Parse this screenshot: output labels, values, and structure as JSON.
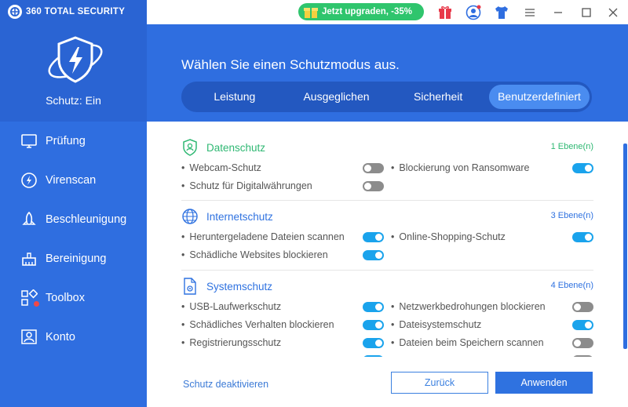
{
  "brand": {
    "name": "360 TOTAL SECURITY"
  },
  "sidebar": {
    "status": "Schutz: Ein",
    "items": [
      {
        "label": "Prüfung",
        "icon": "monitor-icon"
      },
      {
        "label": "Virenscan",
        "icon": "lightning-circle-icon"
      },
      {
        "label": "Beschleunigung",
        "icon": "rocket-icon"
      },
      {
        "label": "Bereinigung",
        "icon": "broom-icon"
      },
      {
        "label": "Toolbox",
        "icon": "grid-icon"
      },
      {
        "label": "Konto",
        "icon": "account-icon"
      }
    ]
  },
  "topbar": {
    "upgrade_label": "Jetzt upgraden, -35%",
    "colors": {
      "upgrade": "#2fc56d",
      "gift": "#e8394a",
      "shirt": "#2f6ee0"
    }
  },
  "header": {
    "title": "Wählen Sie einen Schutzmodus aus.",
    "tabs": [
      "Leistung",
      "Ausgeglichen",
      "Sicherheit",
      "Benutzerdefiniert"
    ],
    "active_tab": "Benutzerdefiniert"
  },
  "sections": [
    {
      "title": "Datenschutz",
      "level": "1 Ebene(n)",
      "color": "#2fb873",
      "items": [
        {
          "label": "Webcam-Schutz",
          "on": false
        },
        {
          "label": "Blockierung von Ransomware",
          "on": true
        },
        {
          "label": "Schutz für Digitalwährungen",
          "on": false
        }
      ]
    },
    {
      "title": "Internetschutz",
      "level": "3 Ebene(n)",
      "color": "#2f72e0",
      "items": [
        {
          "label": "Heruntergeladene Dateien scannen",
          "on": true
        },
        {
          "label": "Online-Shopping-Schutz",
          "on": true
        },
        {
          "label": "Schädliche Websites blockieren",
          "on": true
        }
      ]
    },
    {
      "title": "Systemschutz",
      "level": "4 Ebene(n)",
      "color": "#2f72e0",
      "items": [
        {
          "label": "USB-Laufwerkschutz",
          "on": true
        },
        {
          "label": "Netzwerkbedrohungen blockieren",
          "on": false
        },
        {
          "label": "Schädliches Verhalten blockieren",
          "on": true
        },
        {
          "label": "Dateisystemschutz",
          "on": true
        },
        {
          "label": "Registrierungsschutz",
          "on": true
        },
        {
          "label": "Dateien beim Speichern scannen",
          "on": false
        }
      ]
    }
  ],
  "footer": {
    "deactivate_label": "Schutz deaktivieren",
    "back_label": "Zurück",
    "apply_label": "Anwenden"
  }
}
